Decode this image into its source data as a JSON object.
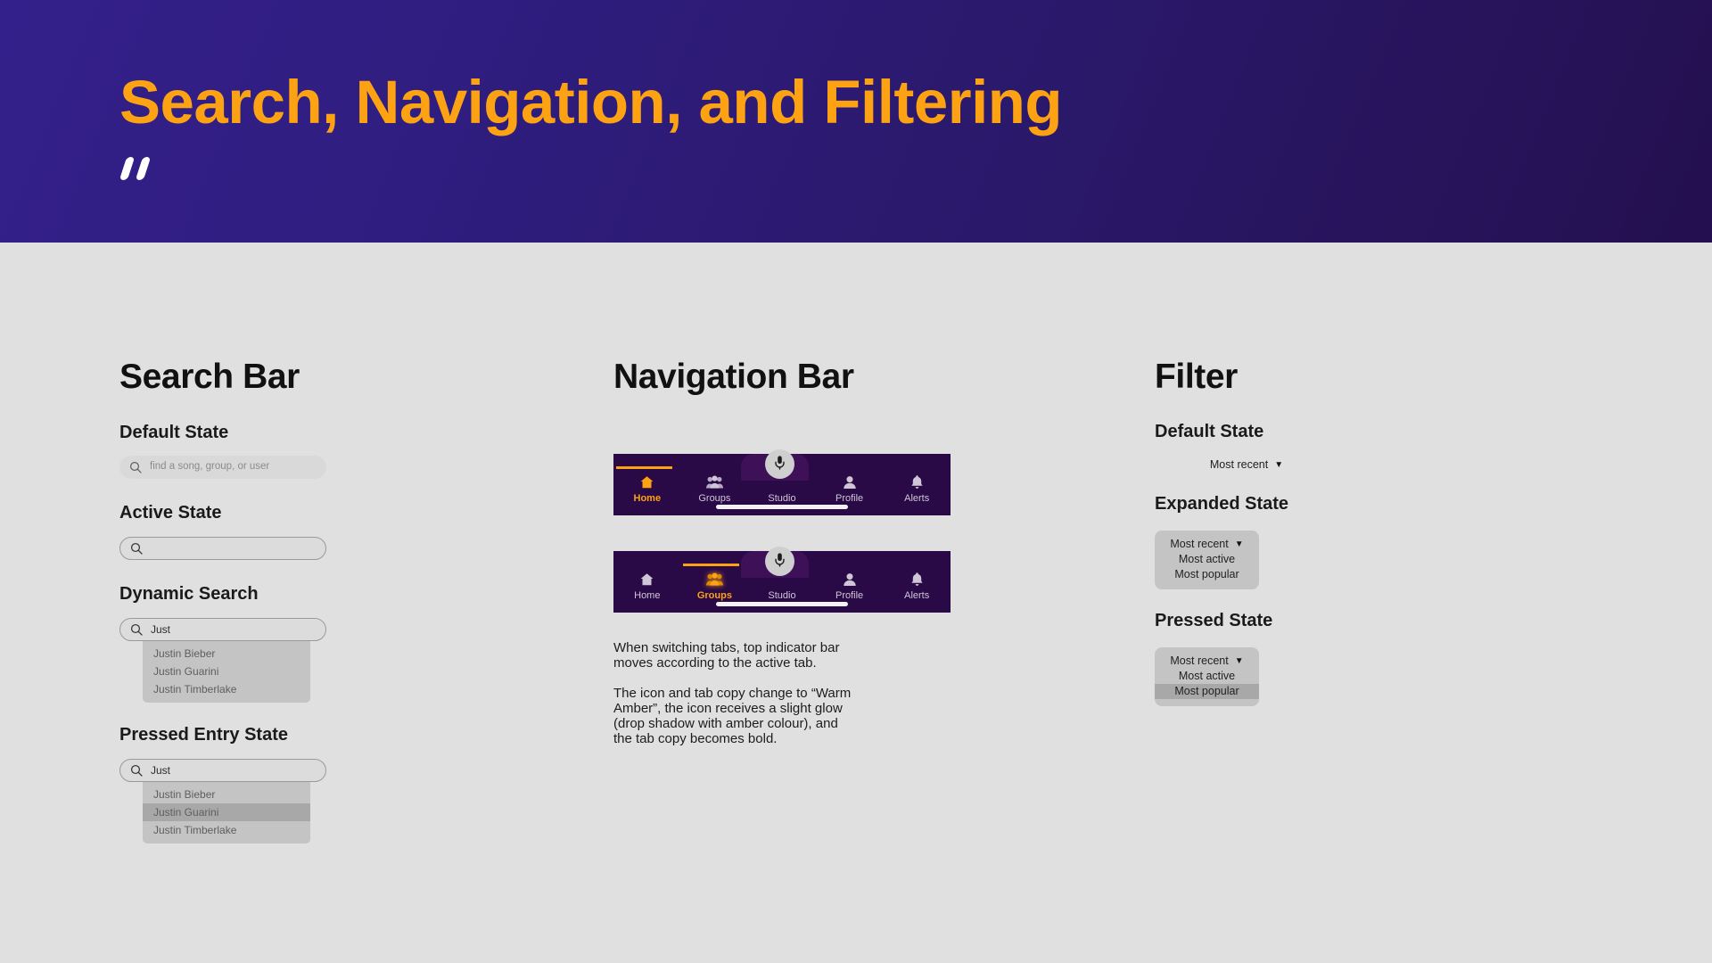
{
  "header": {
    "title": "Search, Navigation, and Filtering",
    "mark": "double-slash-logo",
    "gradient_from": "#34208a",
    "gradient_to": "#24104f",
    "title_color": "#fca213"
  },
  "search_column": {
    "heading": "Search Bar",
    "default_state": {
      "label": "Default State",
      "placeholder": "find a song, group, or user",
      "value": ""
    },
    "active_state": {
      "label": "Active State",
      "placeholder": "",
      "value": ""
    },
    "dynamic_search": {
      "label": "Dynamic Search",
      "value": "Just",
      "suggestions": [
        "Justin Bieber",
        "Justin Guarini",
        "Justin Timberlake"
      ],
      "selected_index": -1
    },
    "pressed_entry_state": {
      "label": "Pressed Entry State",
      "value": "Just",
      "suggestions": [
        "Justin Bieber",
        "Justin Guarini",
        "Justin Timberlake"
      ],
      "selected_index": 1
    }
  },
  "nav_column": {
    "heading": "Navigation Bar",
    "accent_color": "#fca213",
    "bar_color": "#2a0a46",
    "notch_color": "#3d1057",
    "bar_default": {
      "active_index": 0,
      "tabs": [
        {
          "label": "Home",
          "icon": "home-icon"
        },
        {
          "label": "Groups",
          "icon": "groups-icon"
        },
        {
          "label": "Studio",
          "icon": "microphone-icon"
        },
        {
          "label": "Profile",
          "icon": "person-icon"
        },
        {
          "label": "Alerts",
          "icon": "bell-icon"
        }
      ]
    },
    "bar_switched": {
      "active_index": 1,
      "tabs": [
        {
          "label": "Home",
          "icon": "home-icon"
        },
        {
          "label": "Groups",
          "icon": "groups-icon"
        },
        {
          "label": "Studio",
          "icon": "microphone-icon"
        },
        {
          "label": "Profile",
          "icon": "person-icon"
        },
        {
          "label": "Alerts",
          "icon": "bell-icon"
        }
      ]
    },
    "notes": [
      "When switching tabs, top indicator bar moves according to the active tab.",
      "The icon and tab copy change to “Warm Amber”, the icon receives a slight glow (drop shadow with amber colour), and the tab copy becomes bold."
    ]
  },
  "filter_column": {
    "heading": "Filter",
    "default_state": {
      "label": "Default State",
      "selected": "Most recent",
      "caret": "▼"
    },
    "expanded_state": {
      "label": "Expanded State",
      "options": [
        "Most recent",
        "Most active",
        "Most popular"
      ],
      "selected_index": 0,
      "pressed_index": -1,
      "caret": "▼"
    },
    "pressed_state": {
      "label": "Pressed State",
      "options": [
        "Most recent",
        "Most active",
        "Most popular"
      ],
      "selected_index": 0,
      "pressed_index": 2,
      "caret": "▼"
    }
  }
}
